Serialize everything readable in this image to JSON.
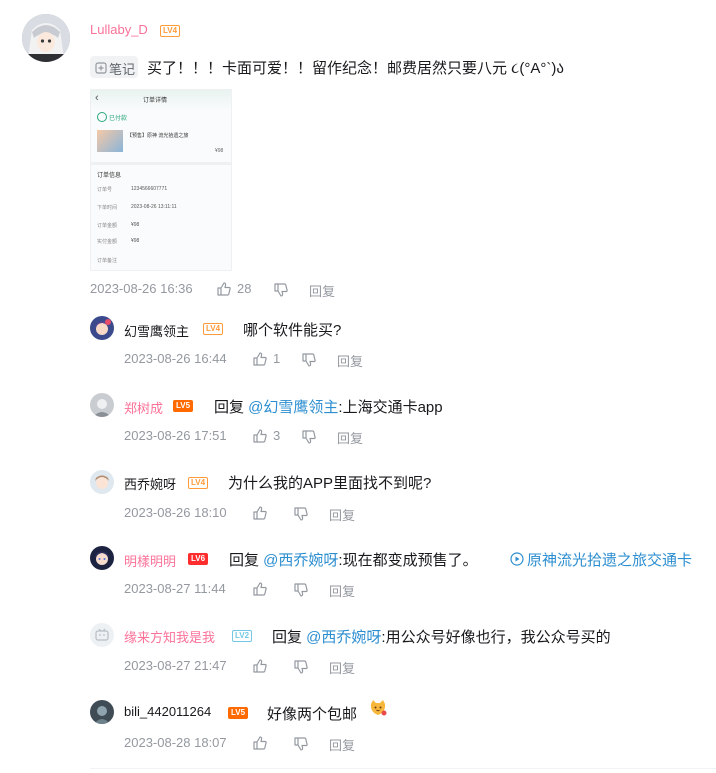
{
  "main_comment": {
    "username": "Lullaby_D",
    "level": "LV4",
    "tag_label": "笔记",
    "text": "买了！！！卡面可爱！！留作纪念！邮费居然只要八元 ૮(°A°`)ა",
    "timestamp": "2023-08-26 16:36",
    "likes": "28",
    "reply_label": "回复",
    "screenshot": {
      "header_title": "订单详情",
      "status": "已付款",
      "product_title": "【预售】原神 流光拾遗之旅",
      "product_price": "¥98",
      "section_title": "订单信息",
      "rows": [
        {
          "label": "订单号",
          "value": "1234566607771"
        },
        {
          "label": "下单时间",
          "value": "2023-08-26 13:11:11"
        },
        {
          "label": "订单金额",
          "value": "¥98"
        },
        {
          "label": "实付金额",
          "value": "¥98"
        }
      ],
      "footer": "订单备注"
    }
  },
  "replies": [
    {
      "username": "幻雪鹰领主",
      "level": "LV4",
      "prefix": "",
      "mention": "",
      "text": "哪个软件能买?",
      "link": "",
      "timestamp": "2023-08-26 16:44",
      "likes": "1",
      "reply_label": "回复",
      "name_color": "#18191c",
      "level_color": "#ff9b3a"
    },
    {
      "username": "郑树成",
      "level": "LV5",
      "prefix": "回复 ",
      "mention": "@幻雪鹰领主",
      "text": ":上海交通卡app",
      "link": "",
      "timestamp": "2023-08-26 17:51",
      "likes": "3",
      "reply_label": "回复",
      "name_color": "#fb7299",
      "level_color": "#ff6a00"
    },
    {
      "username": "西乔婉呀",
      "level": "LV4",
      "prefix": "",
      "mention": "",
      "text": "为什么我的APP里面找不到呢?",
      "link": "",
      "timestamp": "2023-08-26 18:10",
      "likes": "",
      "reply_label": "回复",
      "name_color": "#18191c",
      "level_color": "#ff9b3a"
    },
    {
      "username": "明樣明明",
      "level": "LV6",
      "prefix": "回复 ",
      "mention": "@西乔婉呀",
      "text": ":现在都变成预售了。",
      "link": "原神流光拾遗之旅交通卡",
      "timestamp": "2023-08-27 11:44",
      "likes": "",
      "reply_label": "回复",
      "name_color": "#fb7299",
      "level_color": "#ff2d2d"
    },
    {
      "username": "缘来方知我是我",
      "level": "LV2",
      "prefix": "回复 ",
      "mention": "@西乔婉呀",
      "text": ":用公众号好像也行，我公众号买的",
      "link": "",
      "timestamp": "2023-08-27 21:47",
      "likes": "",
      "reply_label": "回复",
      "name_color": "#fb7299",
      "level_color": "#73c9e5"
    },
    {
      "username": "bili_442011264",
      "level": "LV5",
      "prefix": "",
      "mention": "",
      "text": "好像两个包邮",
      "link": "",
      "timestamp": "2023-08-28 18:07",
      "likes": "",
      "reply_label": "回复",
      "name_color": "#18191c",
      "level_color": "#ff6a00"
    }
  ],
  "colors": {
    "accent": "#fb7299",
    "link": "#2c8ed0",
    "meta": "#9499a0"
  }
}
